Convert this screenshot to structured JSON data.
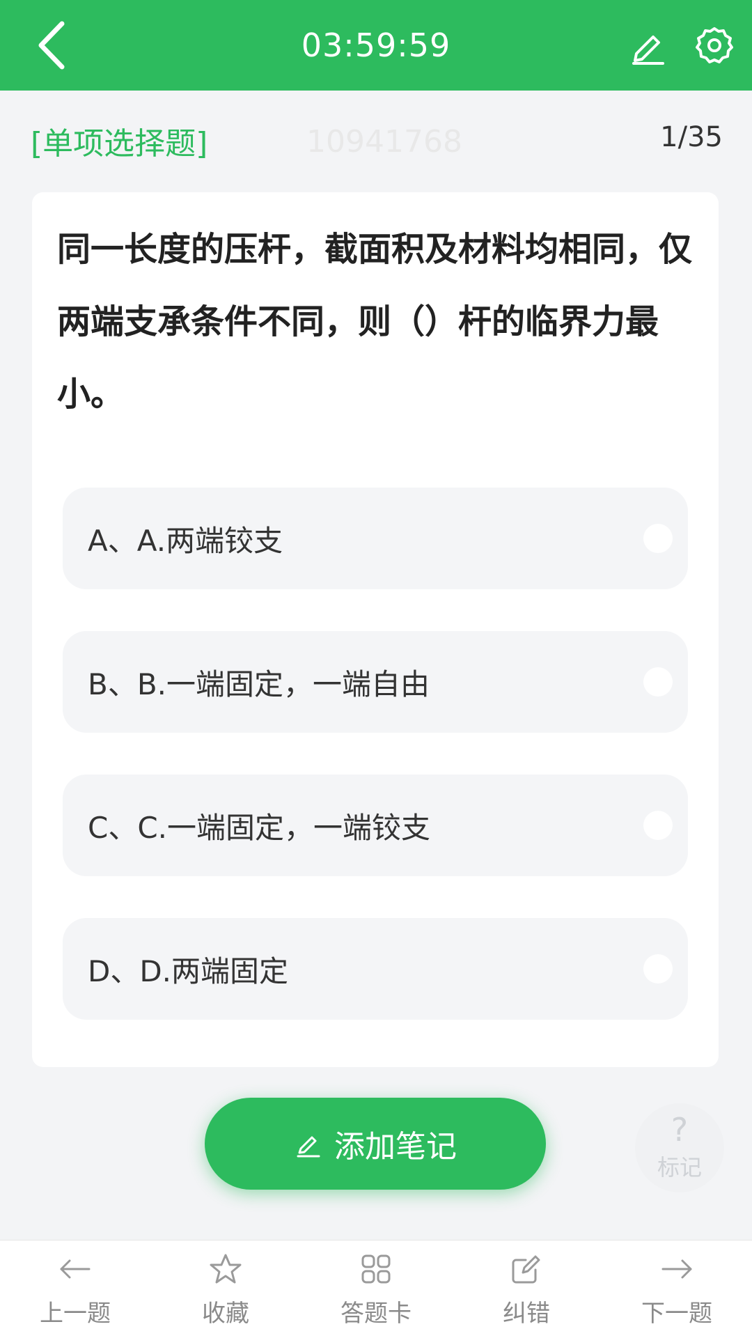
{
  "header": {
    "timer": "03:59:59",
    "icons": {
      "back": "chevron-left-icon",
      "edit": "pencil-icon",
      "settings": "gear-icon"
    },
    "bg_color": "#2dbb5e"
  },
  "meta": {
    "type": "[单项选择题]",
    "watermark_id": "10941768",
    "progress": "1/35"
  },
  "question": {
    "text": "同一长度的压杆，截面积及材料均相同，仅两端支承条件不同，则（）杆的临界力最小。"
  },
  "options": [
    {
      "label": "A、A.两端铰支"
    },
    {
      "label": "B、B.一端固定，一端自由"
    },
    {
      "label": "C、C.一端固定，一端铰支"
    },
    {
      "label": "D、D.两端固定"
    }
  ],
  "actions": {
    "add_note": "添加笔记",
    "mark_question": "?",
    "mark_label": "标记"
  },
  "footer": {
    "items": [
      {
        "label": "上一题",
        "icon": "arrow-left-icon"
      },
      {
        "label": "收藏",
        "icon": "star-icon"
      },
      {
        "label": "答题卡",
        "icon": "grid-icon"
      },
      {
        "label": "纠错",
        "icon": "edit-square-icon"
      },
      {
        "label": "下一题",
        "icon": "arrow-right-icon"
      }
    ]
  },
  "colors": {
    "accent": "#2dbb5e",
    "background": "#f3f4f6",
    "card": "#ffffff",
    "option_bg": "#f4f5f7",
    "footer_text": "#8a8a8a"
  }
}
